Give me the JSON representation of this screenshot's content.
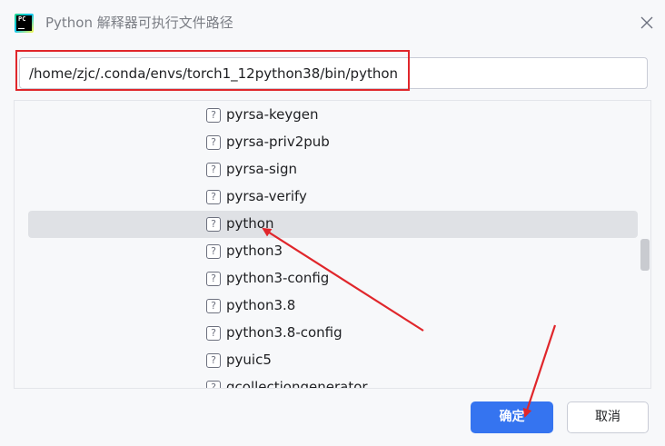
{
  "dialog": {
    "title": "Python 解释器可执行文件路径",
    "app_icon": "pycharm-logo",
    "app_icon_letters": "PC",
    "close_icon": "close-icon"
  },
  "path_input": {
    "value": "/home/zjc/.conda/envs/torch1_12python38/bin/python"
  },
  "file_list": {
    "item_icon": "unknown-file-icon",
    "item_icon_glyph": "?",
    "selected_index": 4,
    "items": [
      {
        "name": "pyrsa-keygen"
      },
      {
        "name": "pyrsa-priv2pub"
      },
      {
        "name": "pyrsa-sign"
      },
      {
        "name": "pyrsa-verify"
      },
      {
        "name": "python"
      },
      {
        "name": "python3"
      },
      {
        "name": "python3-config"
      },
      {
        "name": "python3.8"
      },
      {
        "name": "python3.8-config"
      },
      {
        "name": "pyuic5"
      },
      {
        "name": "qcollectiongenerator"
      }
    ]
  },
  "buttons": {
    "ok_label": "确定",
    "cancel_label": "取消"
  },
  "annotation": {
    "color": "#e0262b"
  },
  "colors": {
    "accent": "#3574f0",
    "selection": "#dfe1e5",
    "annotation_red": "#e0262b"
  }
}
